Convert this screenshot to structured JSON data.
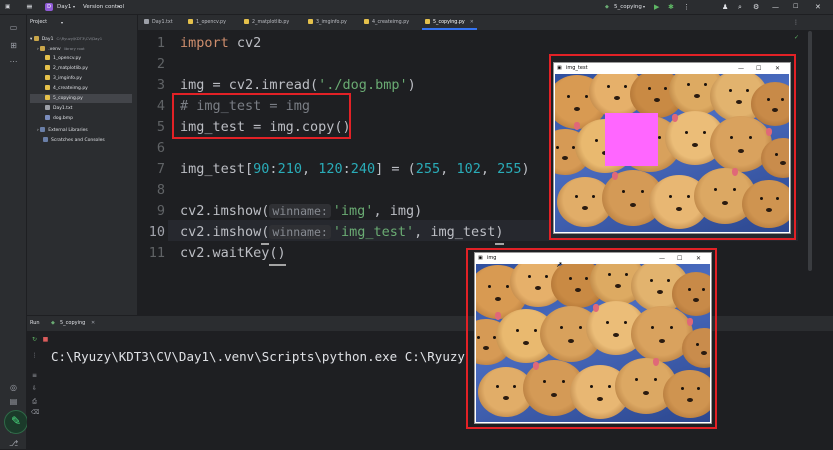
{
  "titlebar": {
    "project_badge": "D",
    "project_name": "Day1",
    "vcs": "Version control",
    "run_config": "5_copying"
  },
  "project_panel": {
    "title": "Project",
    "root": "Day1",
    "root_path": "C:\\Ryuzy\\KDT3\\CV\\Day1",
    "venv": ".venv",
    "venv_note": "library root",
    "files": [
      "1_opencv.py",
      "2_matplotlib.py",
      "3_imginfo.py",
      "4_createimg.py",
      "5_copying.py",
      "Day1.txt",
      "dog.bmp"
    ],
    "external": "External Libraries",
    "scratches": "Scratches and Consoles"
  },
  "tabs": [
    "Day1.txt",
    "1_opencv.py",
    "2_matplotlib.py",
    "3_imginfo.py",
    "4_createimg.py",
    "5_copying.py"
  ],
  "editor": {
    "line_numbers": [
      "1",
      "2",
      "3",
      "4",
      "5",
      "6",
      "7",
      "8",
      "9",
      "10",
      "11"
    ],
    "l1_kw": "import",
    "l1_rest": " cv2",
    "l3_a": "img = cv2.imread(",
    "l3_str": "'./dog.bmp'",
    "l3_b": ")",
    "l4": "# img_test = img",
    "l5": "img_test = img.copy()",
    "l7_a": "img_test[",
    "l7_n1": "90",
    "l7_c1": ":",
    "l7_n2": "210",
    "l7_c2": ", ",
    "l7_n3": "120",
    "l7_c3": ":",
    "l7_n4": "240",
    "l7_c4": "] = (",
    "l7_n5": "255",
    "l7_c5": ", ",
    "l7_n6": "102",
    "l7_c6": ", ",
    "l7_n7": "255",
    "l7_c7": ")",
    "l9_a": "cv2.imshow(",
    "l9_hint": "winname:",
    "l9_str": "'img'",
    "l9_b": ", img)",
    "l10_a": "cv2.imshow",
    "l10_paren": "(",
    "l10_hint": "winname:",
    "l10_str": "'img_test'",
    "l10_b": ", img_test",
    "l10_close": ")",
    "l11_a": "cv2.waitKey",
    "l11_b": "()"
  },
  "run_panel": {
    "label": "Run",
    "config": "5_copying",
    "command": "C:\\Ryuzy\\KDT3\\CV\\Day1\\.venv\\Scripts\\python.exe C:\\Ryuzy"
  },
  "cv_windows": {
    "img_test_title": "img_test",
    "img_title": "img",
    "pink_color": "#ff66ff"
  },
  "colors": {
    "accent": "#3574f0",
    "highlight_red": "#e22126"
  }
}
